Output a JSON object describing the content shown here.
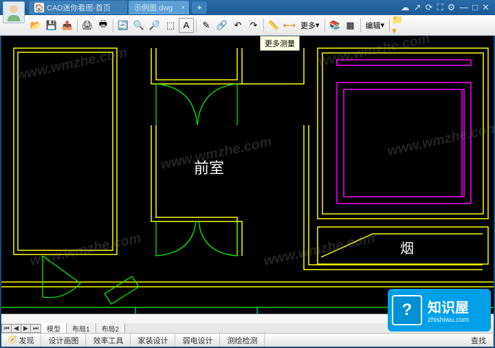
{
  "tabs": [
    {
      "label": "CAD迷你看图-首页"
    },
    {
      "label": "示例图.dwg"
    }
  ],
  "toolbar": {
    "more_label": "更多",
    "edit_label": "编辑"
  },
  "tooltip": "更多测量",
  "drawing": {
    "room1_label": "前室",
    "room2_label": "烟"
  },
  "layout_tabs": {
    "model": "模型",
    "l1": "布局1",
    "l2": "布局2"
  },
  "status": {
    "discover": "发现",
    "design": "设计画图",
    "eff": "效率工具",
    "home": "家装设计",
    "elec": "弱电设计",
    "survey": "测绘检测",
    "search": "查找"
  },
  "watermarks": [
    "www.wmzhe.com",
    "www.wmzhe.com",
    "www.wmzhe.com",
    "www.wmzhe.com",
    "www.wmzhe.com",
    "www.wmzhe.com"
  ],
  "badge": {
    "q": "?",
    "title": "知识屋",
    "sub": "zhishiwu.com"
  }
}
